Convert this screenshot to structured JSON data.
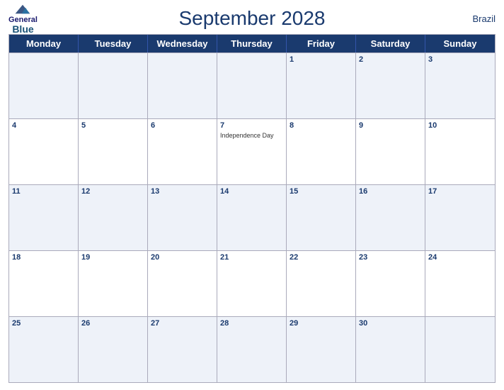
{
  "header": {
    "title": "September 2028",
    "country": "Brazil",
    "logo": {
      "line1": "General",
      "line2": "Blue"
    }
  },
  "dayHeaders": [
    "Monday",
    "Tuesday",
    "Wednesday",
    "Thursday",
    "Friday",
    "Saturday",
    "Sunday"
  ],
  "weeks": [
    [
      {
        "date": "",
        "event": ""
      },
      {
        "date": "",
        "event": ""
      },
      {
        "date": "",
        "event": ""
      },
      {
        "date": "",
        "event": ""
      },
      {
        "date": "1",
        "event": ""
      },
      {
        "date": "2",
        "event": ""
      },
      {
        "date": "3",
        "event": ""
      }
    ],
    [
      {
        "date": "4",
        "event": ""
      },
      {
        "date": "5",
        "event": ""
      },
      {
        "date": "6",
        "event": ""
      },
      {
        "date": "7",
        "event": "Independence Day"
      },
      {
        "date": "8",
        "event": ""
      },
      {
        "date": "9",
        "event": ""
      },
      {
        "date": "10",
        "event": ""
      }
    ],
    [
      {
        "date": "11",
        "event": ""
      },
      {
        "date": "12",
        "event": ""
      },
      {
        "date": "13",
        "event": ""
      },
      {
        "date": "14",
        "event": ""
      },
      {
        "date": "15",
        "event": ""
      },
      {
        "date": "16",
        "event": ""
      },
      {
        "date": "17",
        "event": ""
      }
    ],
    [
      {
        "date": "18",
        "event": ""
      },
      {
        "date": "19",
        "event": ""
      },
      {
        "date": "20",
        "event": ""
      },
      {
        "date": "21",
        "event": ""
      },
      {
        "date": "22",
        "event": ""
      },
      {
        "date": "23",
        "event": ""
      },
      {
        "date": "24",
        "event": ""
      }
    ],
    [
      {
        "date": "25",
        "event": ""
      },
      {
        "date": "26",
        "event": ""
      },
      {
        "date": "27",
        "event": ""
      },
      {
        "date": "28",
        "event": ""
      },
      {
        "date": "29",
        "event": ""
      },
      {
        "date": "30",
        "event": ""
      },
      {
        "date": "",
        "event": ""
      }
    ]
  ]
}
